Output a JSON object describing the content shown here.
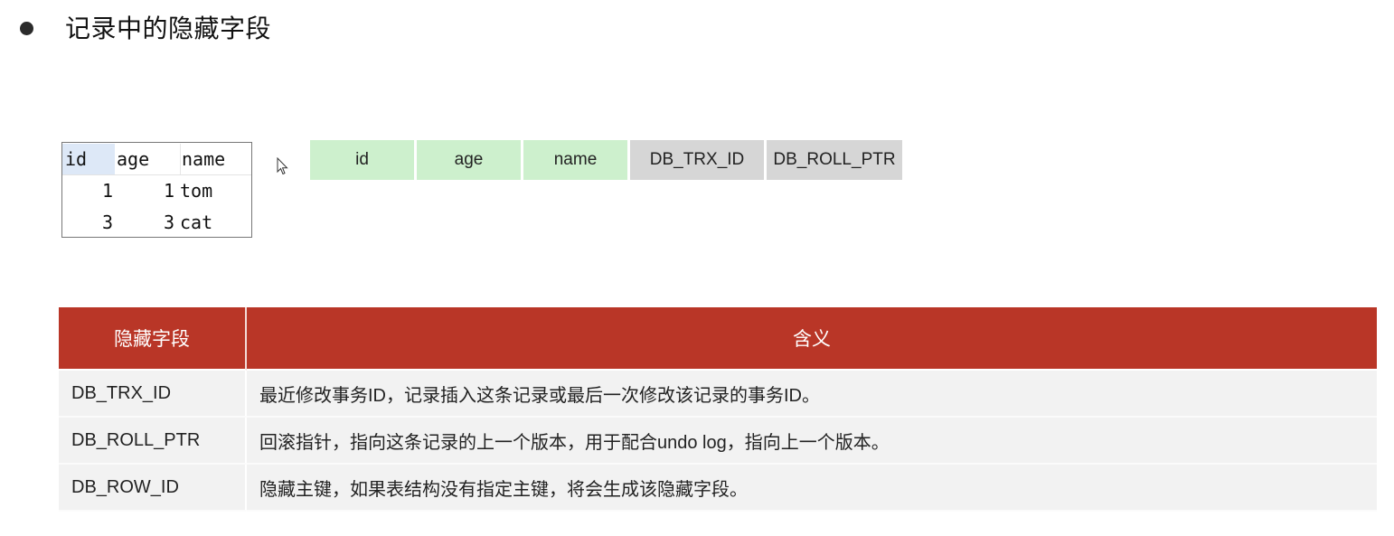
{
  "heading": "记录中的隐藏字段",
  "mini_grid": {
    "columns": [
      "id",
      "age",
      "name"
    ],
    "rows": [
      {
        "id": "1",
        "age": "1",
        "name": "tom"
      },
      {
        "id": "3",
        "age": "3",
        "name": "cat"
      }
    ]
  },
  "field_strip": {
    "fields": [
      {
        "label": "id",
        "kind": "user"
      },
      {
        "label": "age",
        "kind": "user"
      },
      {
        "label": "name",
        "kind": "user"
      },
      {
        "label": "DB_TRX_ID",
        "kind": "hidden"
      },
      {
        "label": "DB_ROLL_PTR",
        "kind": "hidden"
      }
    ],
    "colors": {
      "user": "#cdf0cd",
      "hidden": "#d6d6d6"
    }
  },
  "hidden_fields_table": {
    "header_color": "#b93627",
    "headers": [
      "隐藏字段",
      "含义"
    ],
    "rows": [
      {
        "field": "DB_TRX_ID",
        "meaning": "最近修改事务ID，记录插入这条记录或最后一次修改该记录的事务ID。"
      },
      {
        "field": "DB_ROLL_PTR",
        "meaning": "回滚指针，指向这条记录的上一个版本，用于配合undo log，指向上一个版本。"
      },
      {
        "field": "DB_ROW_ID",
        "meaning": "隐藏主键，如果表结构没有指定主键，将会生成该隐藏字段。"
      }
    ]
  }
}
